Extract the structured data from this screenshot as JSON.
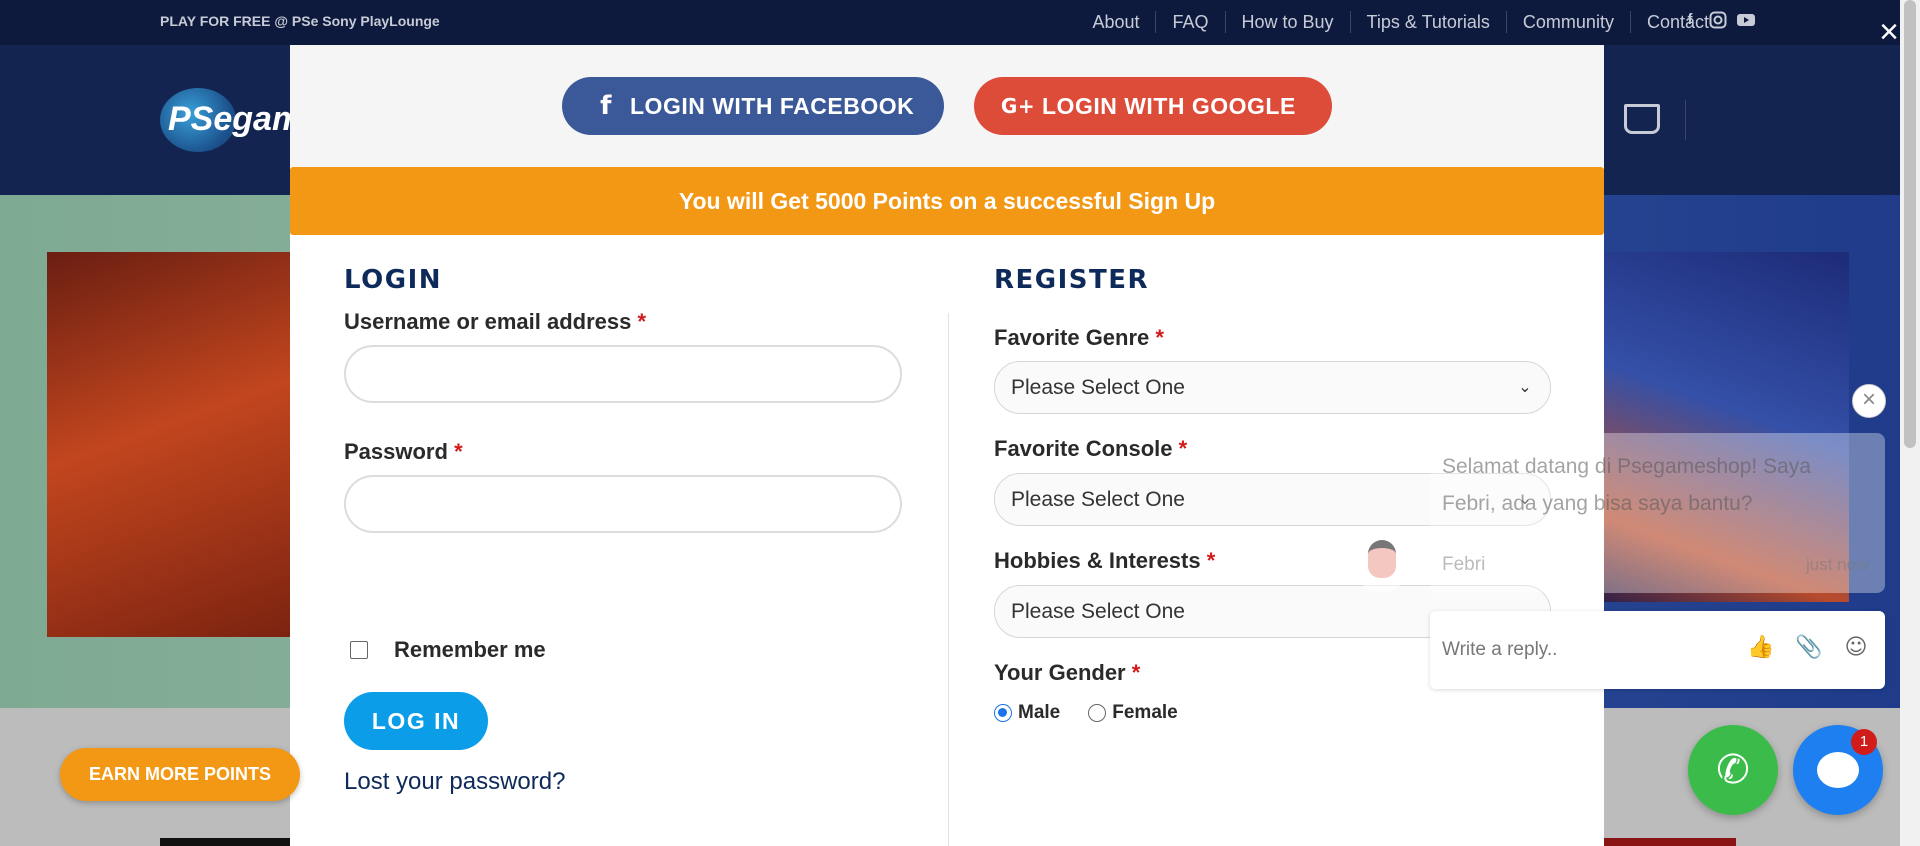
{
  "topbar": {
    "promo": "PLAY FOR FREE @ PSe Sony PlayLounge",
    "nav": [
      "About",
      "FAQ",
      "How to Buy",
      "Tips & Tutorials",
      "Community",
      "Contact"
    ],
    "social_icons": [
      "facebook-icon",
      "instagram-icon",
      "youtube-icon"
    ]
  },
  "header": {
    "logo_text": "PSegam"
  },
  "modal": {
    "facebook_button": "LOGIN WITH FACEBOOK",
    "google_button": "LOGIN WITH GOOGLE",
    "points_banner": "You will Get 5000 Points on a successful Sign Up",
    "login": {
      "title": "LOGIN",
      "username_label": "Username or email address",
      "password_label": "Password",
      "required_mark": "*",
      "remember_label": "Remember me",
      "submit_label": "LOG IN",
      "lost_password": "Lost your password?"
    },
    "register": {
      "title": "REGISTER",
      "genre_label": "Favorite Genre",
      "console_label": "Favorite Console",
      "hobbies_label": "Hobbies & Interests",
      "gender_label": "Your Gender",
      "select_placeholder": "Please Select One",
      "gender_options": [
        "Male",
        "Female"
      ],
      "gender_selected": "Male"
    }
  },
  "earn_button": "EARN MORE POINTS",
  "chat": {
    "message": "Selamat datang di Psegameshop! Saya Febri, ada yang bisa saya bantu?",
    "sender": "Febri",
    "time": "just now",
    "reply_placeholder": "Write a reply..",
    "badge_count": "1"
  },
  "colors": {
    "facebook": "#3b5998",
    "google": "#dd4b39",
    "points": "#f39814",
    "login_button": "#0b9de8",
    "whatsapp": "#3bbc4a",
    "chat": "#1e7ff0"
  }
}
